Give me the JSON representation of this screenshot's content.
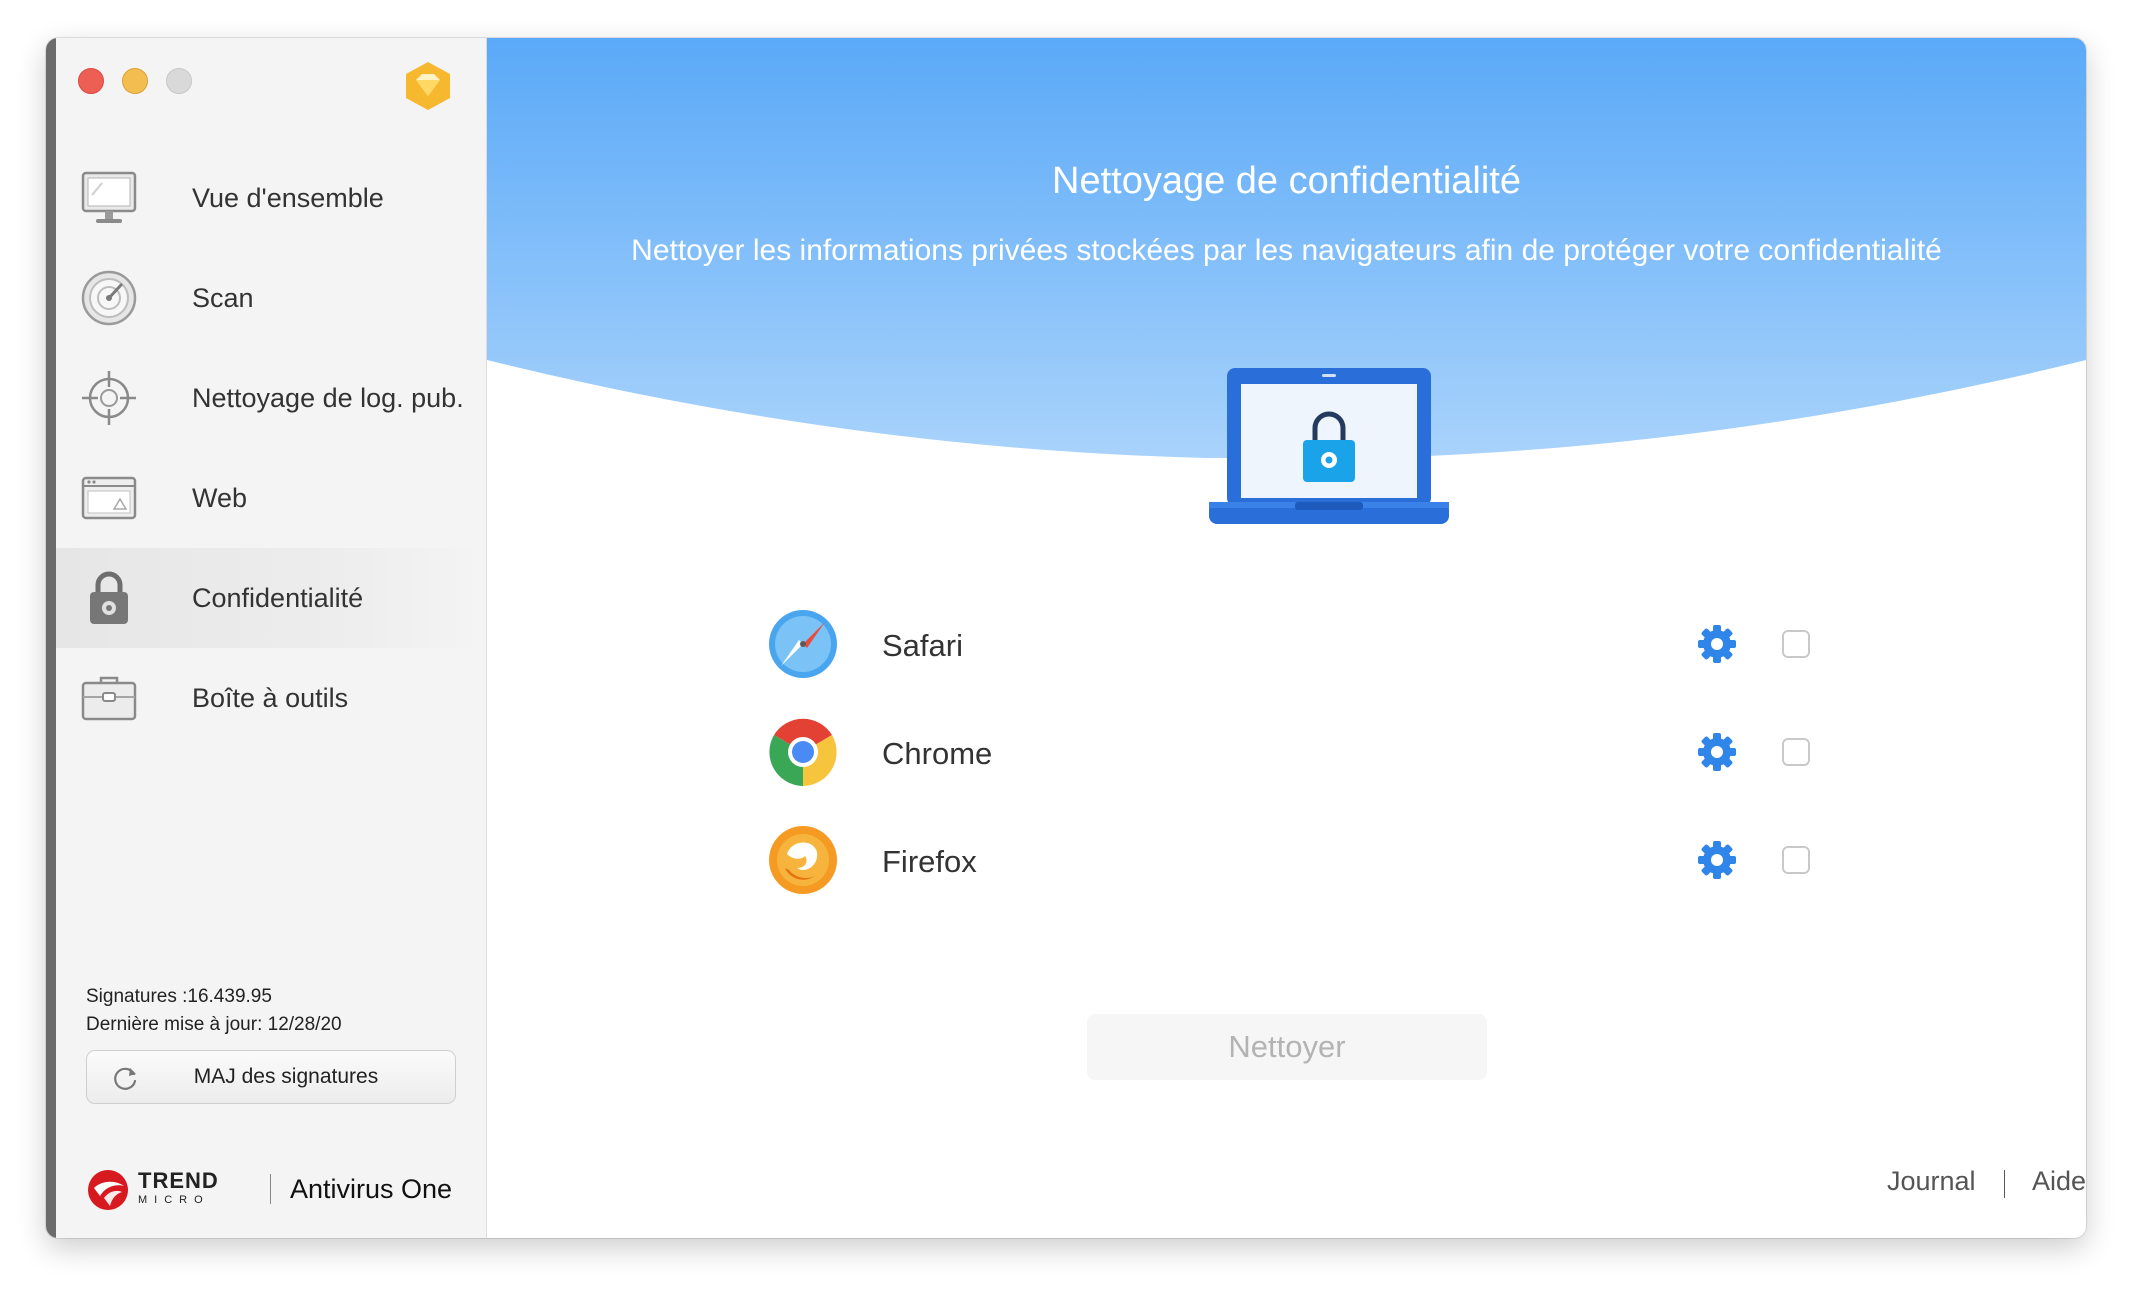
{
  "sidebar": {
    "nav": [
      {
        "label": "Vue d'ensemble",
        "icon": "monitor-icon"
      },
      {
        "label": "Scan",
        "icon": "scan-gauge-icon"
      },
      {
        "label": "Nettoyage de log. pub.",
        "icon": "crosshair-icon"
      },
      {
        "label": "Web",
        "icon": "browser-window-icon"
      },
      {
        "label": "Confidentialité",
        "icon": "padlock-icon"
      },
      {
        "label": "Boîte à outils",
        "icon": "toolbox-icon"
      }
    ],
    "active_item": "Confidentialité",
    "signatures": "Signatures :16.439.95",
    "last_update": "Dernière mise à jour: 12/28/20",
    "update_button": "MAJ des signatures",
    "brand": {
      "trend": "TREND",
      "micro": "MICRO",
      "product": "Antivirus One"
    }
  },
  "main": {
    "title": "Nettoyage de confidentialité",
    "subtitle": "Nettoyer les informations privées stockées par les navigateurs afin de protéger votre confidentialité",
    "browsers": [
      {
        "name": "Safari",
        "icon": "safari-icon",
        "checked": false
      },
      {
        "name": "Chrome",
        "icon": "chrome-icon",
        "checked": false
      },
      {
        "name": "Firefox",
        "icon": "firefox-icon",
        "checked": false
      }
    ],
    "clean_button": "Nettoyer",
    "footer": {
      "journal": "Journal",
      "help": "Aide"
    }
  },
  "colors": {
    "hero_blue_top": "#5aa9f8",
    "hero_blue_bottom": "#a5d0fb",
    "accent_blue": "#2f86e8",
    "laptop_blue": "#2a6fd9",
    "lock_cyan": "#1aa3e8"
  }
}
